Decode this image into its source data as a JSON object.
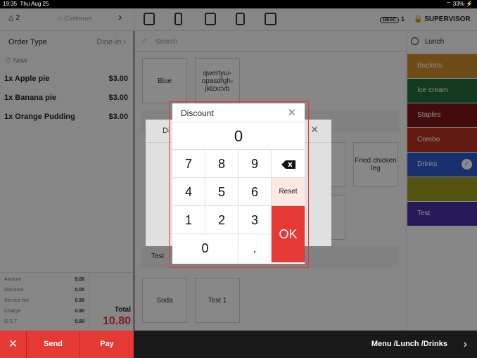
{
  "status": {
    "time": "19:35",
    "date": "Thu Aug 25",
    "battery": "33%"
  },
  "toolbar": {
    "guests": "2",
    "customer": "Customer",
    "desc_badge": "DESC",
    "desc_count": "1",
    "user": "SUPERVISOR"
  },
  "order": {
    "type_label": "Order Type",
    "type_value": "Dine-in",
    "time_label": "Now",
    "items": [
      {
        "name": "1x Apple pie",
        "price": "$3.00"
      },
      {
        "name": "1x Banana pie",
        "price": "$3.00"
      },
      {
        "name": "1x Orange Pudding",
        "price": "$3.00"
      }
    ],
    "summary": [
      {
        "label": "Amount",
        "value": "9.00"
      },
      {
        "label": "Discount",
        "value": "0.00"
      },
      {
        "label": "Service fee",
        "value": "0.90"
      },
      {
        "label": "Charge",
        "value": "0.90"
      },
      {
        "label": "G.S.T",
        "value": "0.90"
      }
    ],
    "total_label": "Total",
    "total_value": "10.80"
  },
  "search": {
    "placeholder": "Search"
  },
  "products": {
    "row1": [
      "Blue",
      "qwertyui-opasdfgh-jklzxcvb"
    ],
    "row2_right": [
      "pie",
      "Fried chicken leg"
    ],
    "cat_label": "Test",
    "row3": [
      "Soda",
      "Test 1"
    ]
  },
  "menu": {
    "header": "Lunch",
    "categories": [
      {
        "name": "Buckets",
        "color": "#c8892a"
      },
      {
        "name": "Ice cream",
        "color": "#1f6b3a"
      },
      {
        "name": "Staples",
        "color": "#7a1414"
      },
      {
        "name": "Combo",
        "color": "#b4321e"
      },
      {
        "name": "Drinks",
        "color": "#2d58c8",
        "selected": true
      },
      {
        "name": "",
        "color": "#9a9a1e"
      },
      {
        "name": "Test",
        "color": "#4a2fa0"
      }
    ]
  },
  "bottom": {
    "cancel": "✕",
    "send": "Send",
    "pay": "Pay",
    "path": "Menu /Lunch /Drinks"
  },
  "bg_dialog": {
    "title": "Di"
  },
  "numpad": {
    "title": "Discount",
    "display": "0",
    "keys": [
      "7",
      "8",
      "9",
      "4",
      "5",
      "6",
      "1",
      "2",
      "3",
      "0",
      "."
    ],
    "reset": "Reset",
    "ok": "OK"
  }
}
